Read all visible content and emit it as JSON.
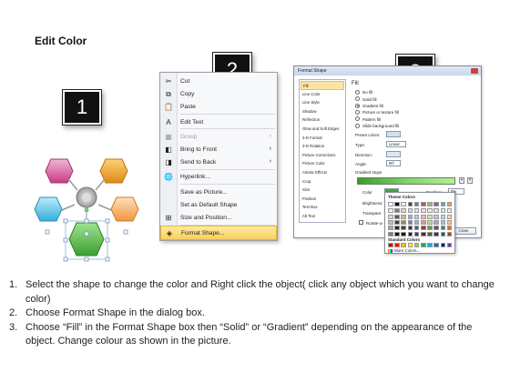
{
  "title": "Edit Color",
  "steps": [
    "1",
    "2",
    "3"
  ],
  "context_menu": {
    "items": [
      {
        "label": "Cut",
        "icon": "scissors-icon",
        "glyph": "✂",
        "disabled": false,
        "arrow": false,
        "selected": false
      },
      {
        "label": "Copy",
        "icon": "copy-icon",
        "glyph": "⧉",
        "disabled": false,
        "arrow": false,
        "selected": false
      },
      {
        "label": "Paste",
        "icon": "paste-icon",
        "glyph": "📋",
        "disabled": false,
        "arrow": false,
        "selected": false
      },
      {
        "label": "Edit Text",
        "icon": "edit-text-icon",
        "glyph": "A",
        "disabled": false,
        "arrow": false,
        "selected": false
      },
      {
        "label": "Group",
        "icon": "group-icon",
        "glyph": "▦",
        "disabled": true,
        "arrow": true,
        "selected": false
      },
      {
        "label": "Bring to Front",
        "icon": "bring-front-icon",
        "glyph": "◧",
        "disabled": false,
        "arrow": true,
        "selected": false
      },
      {
        "label": "Send to Back",
        "icon": "send-back-icon",
        "glyph": "◨",
        "disabled": false,
        "arrow": true,
        "selected": false
      },
      {
        "label": "Hyperlink...",
        "icon": "hyperlink-icon",
        "glyph": "🌐",
        "disabled": false,
        "arrow": false,
        "selected": false
      },
      {
        "label": "Save as Picture...",
        "icon": "",
        "glyph": "",
        "disabled": false,
        "arrow": false,
        "selected": false
      },
      {
        "label": "Set as Default Shape",
        "icon": "",
        "glyph": "",
        "disabled": false,
        "arrow": false,
        "selected": false
      },
      {
        "label": "Size and Position...",
        "icon": "size-position-icon",
        "glyph": "⊞",
        "disabled": false,
        "arrow": false,
        "selected": false
      },
      {
        "label": "Format Shape...",
        "icon": "format-shape-icon",
        "glyph": "◈",
        "disabled": false,
        "arrow": false,
        "selected": true
      }
    ],
    "arrow_glyph": "›"
  },
  "format_dialog": {
    "title": "Format Shape",
    "nav": [
      "Fill",
      "Line Color",
      "Line Style",
      "Shadow",
      "Reflection",
      "Glow and Soft Edges",
      "3-D Format",
      "3-D Rotation",
      "Picture Corrections",
      "Picture Color",
      "Artistic Effects",
      "Crop",
      "Size",
      "Position",
      "Text Box",
      "Alt Text"
    ],
    "nav_selected": "Fill",
    "fill_heading": "Fill",
    "fill_options": [
      {
        "label": "No fill",
        "checked": false
      },
      {
        "label": "Solid fill",
        "checked": false
      },
      {
        "label": "Gradient fill",
        "checked": true
      },
      {
        "label": "Picture or texture fill",
        "checked": false
      },
      {
        "label": "Pattern fill",
        "checked": false
      },
      {
        "label": "Slide background fill",
        "checked": false
      }
    ],
    "preset_colors_label": "Preset colors:",
    "type_label": "Type:",
    "type_value": "Linear",
    "direction_label": "Direction:",
    "angle_label": "Angle:",
    "angle_value": "90°",
    "gradient_stops_label": "Gradient stops",
    "color_label": "Color",
    "position_label": "Position:",
    "position_value": "0%",
    "brightness_label": "Brightness:",
    "transparency_label": "Transpare",
    "rotate_label": "Rotate w",
    "close_button": "Close"
  },
  "color_palette": {
    "theme_colors_label": "Theme Colors",
    "standard_colors_label": "Standard Colors",
    "more_colors_label": "More Colors..."
  },
  "instructions": [
    {
      "num": "1.",
      "text": "Select the shape to change the color and Right click the object( click any object which you want to change color)"
    },
    {
      "num": "2.",
      "text": "Choose Format Shape in the dialog box."
    },
    {
      "num": "3.",
      "text": "Choose “Fill” in the Format Shape box then “Solid” or “Gradient” depending on the appearance of the object. Change colour as shown in the picture."
    }
  ],
  "colors": {
    "hex_pink": "#d9569c",
    "hex_orange": "#f0a02a",
    "hex_light_orange": "#f6b26b",
    "hex_cyan": "#5ec6e6",
    "hex_green": "#58c24e",
    "hub_grey": "#c9c9c9",
    "gradient_green": "#4aa83a"
  }
}
